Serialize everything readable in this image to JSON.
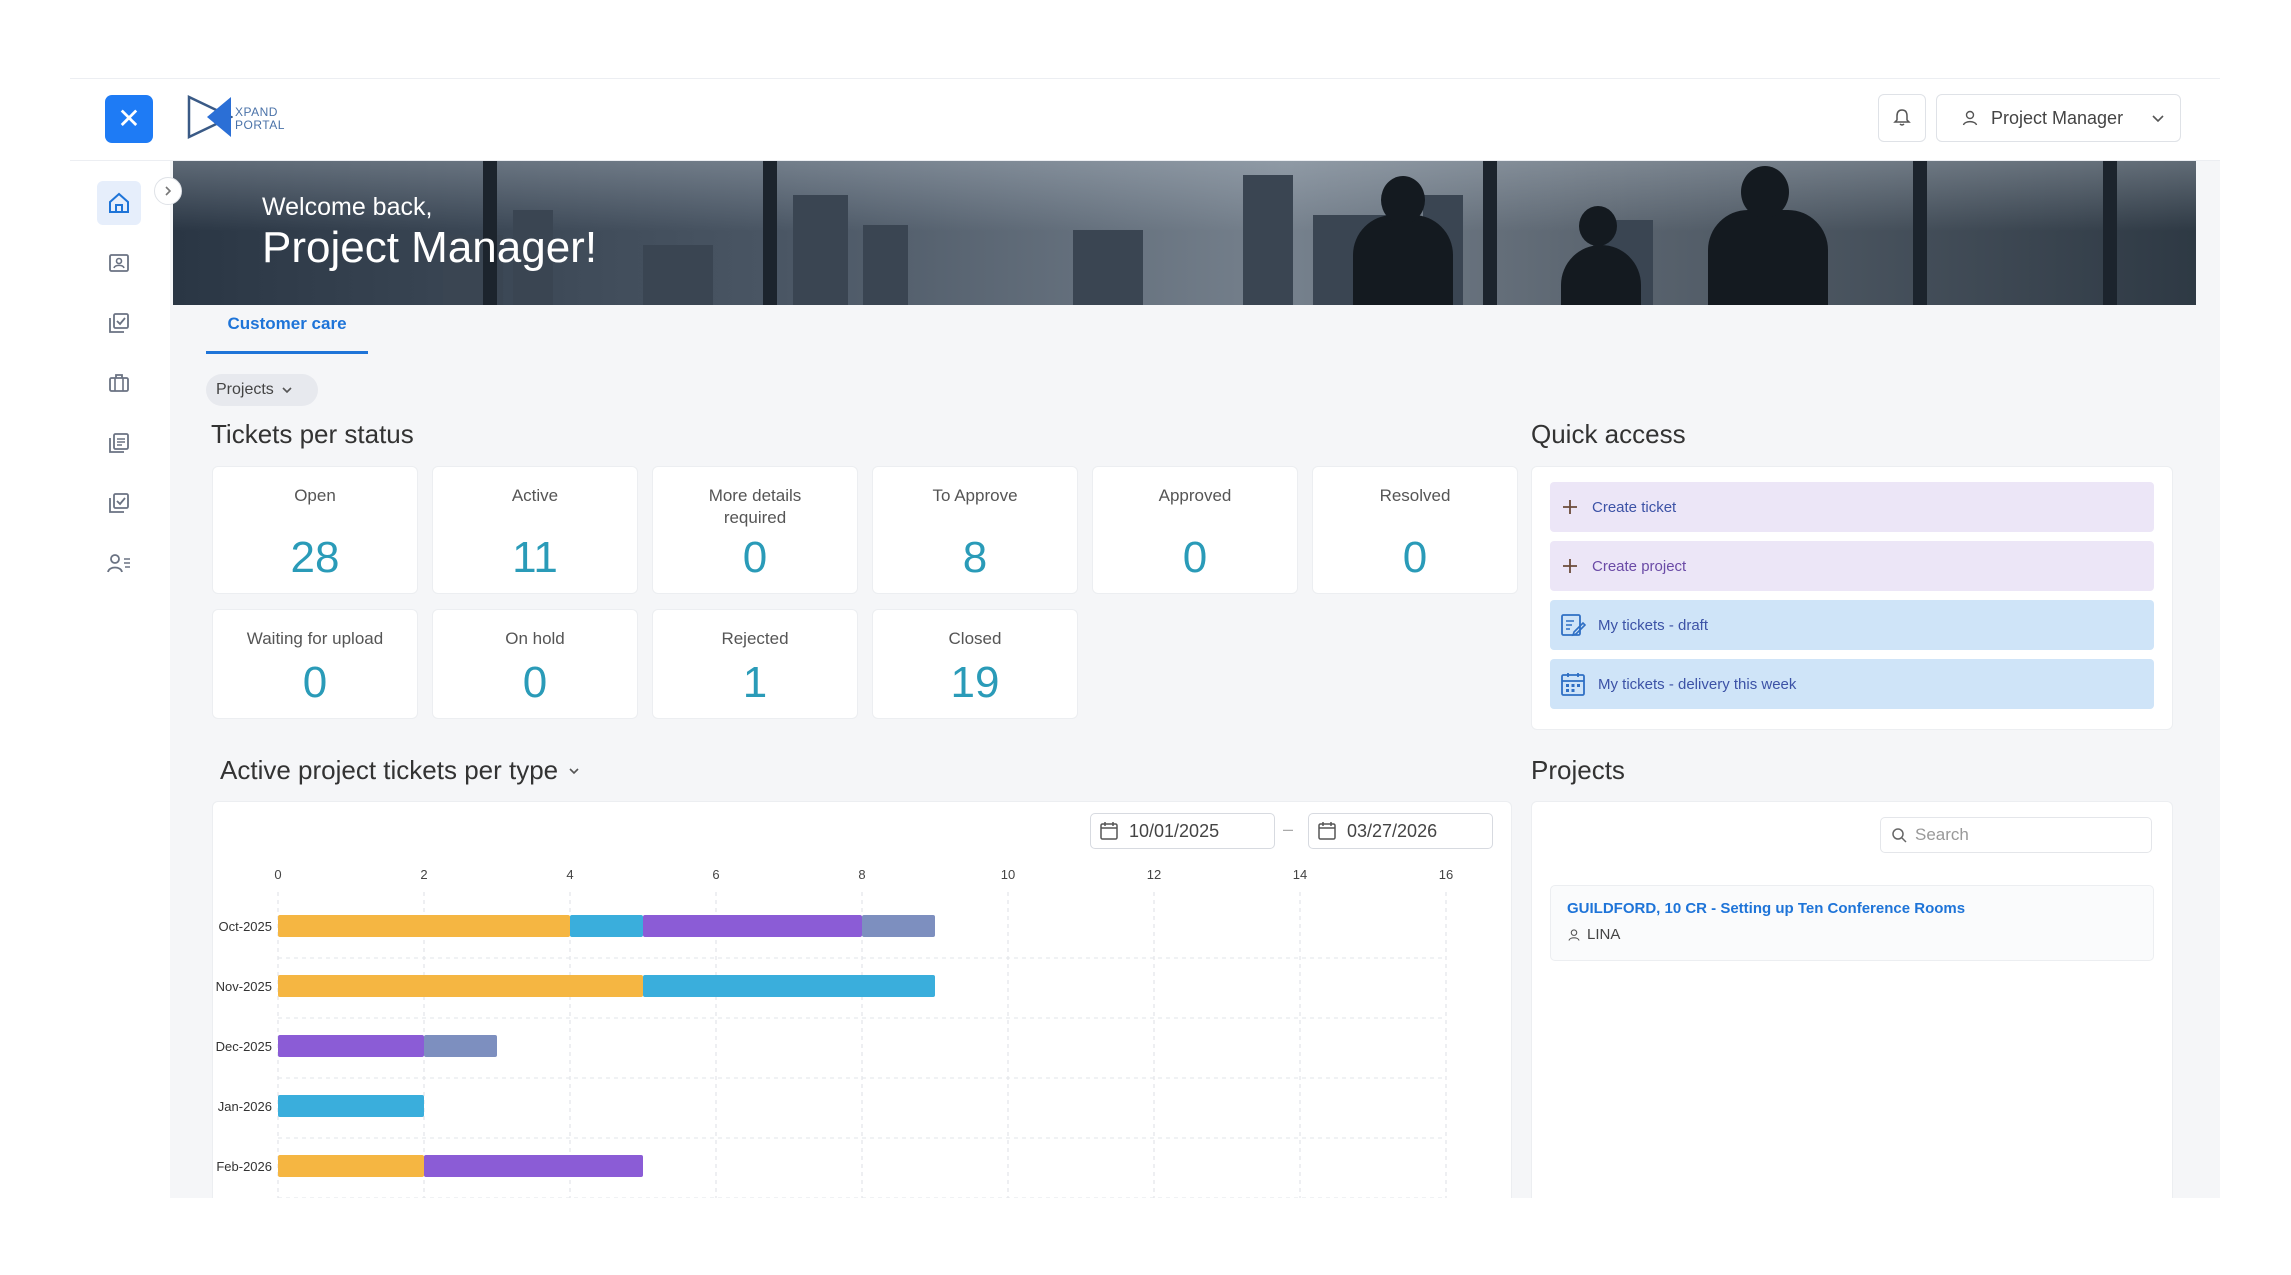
{
  "topbar": {
    "logo_text_line1": "XPAND",
    "logo_text_line2": "PORTAL",
    "user_label": "Project Manager"
  },
  "banner": {
    "greeting": "Welcome back,",
    "name": "Project Manager!"
  },
  "tabs": [
    {
      "label": "Customer care",
      "active": true
    }
  ],
  "filter": {
    "label": "Projects"
  },
  "tickets": {
    "title": "Tickets per status",
    "cards": [
      {
        "label": "Open",
        "value": "28"
      },
      {
        "label": "Active",
        "value": "11"
      },
      {
        "label": "More details required",
        "value": "0"
      },
      {
        "label": "To Approve",
        "value": "8"
      },
      {
        "label": "Approved",
        "value": "0"
      },
      {
        "label": "Resolved",
        "value": "0"
      },
      {
        "label": "Waiting for upload",
        "value": "0"
      },
      {
        "label": "On hold",
        "value": "0"
      },
      {
        "label": "Rejected",
        "value": "1"
      },
      {
        "label": "Closed",
        "value": "19"
      }
    ]
  },
  "quick_access": {
    "title": "Quick access",
    "items": [
      {
        "label": "Create ticket",
        "icon": "plus-icon",
        "style": "purple"
      },
      {
        "label": "Create project",
        "icon": "plus-icon",
        "style": "purple"
      },
      {
        "label": "My tickets - draft",
        "icon": "edit-list-icon",
        "style": "blue"
      },
      {
        "label": "My tickets - delivery this week",
        "icon": "calendar-icon",
        "style": "blue"
      }
    ]
  },
  "chart_section": {
    "title": "Active project tickets per type",
    "date_from": "10/01/2025",
    "date_separator": "–",
    "date_to": "03/27/2026"
  },
  "projects": {
    "title": "Projects",
    "search_placeholder": "Search",
    "items": [
      {
        "title": "GUILDFORD, 10 CR - Setting up Ten Conference Rooms",
        "owner": "LINA"
      }
    ]
  },
  "chart_data": {
    "type": "bar",
    "orientation": "horizontal",
    "stacked": true,
    "categories": [
      "Oct-2025",
      "Nov-2025",
      "Dec-2025",
      "Jan-2026",
      "Feb-2026"
    ],
    "xlim": [
      0,
      16
    ],
    "xticks": [
      0,
      2,
      4,
      6,
      8,
      10,
      12,
      14,
      16
    ],
    "grid": true,
    "series": [
      {
        "color": "#f5b642",
        "values": [
          4,
          5,
          0,
          0,
          2
        ]
      },
      {
        "color": "#3aaedc",
        "values": [
          1,
          4,
          0,
          2,
          0
        ]
      },
      {
        "color": "#8b5cd6",
        "values": [
          3,
          0,
          2,
          0,
          3
        ]
      },
      {
        "color": "#7d8fbf",
        "values": [
          1,
          0,
          1,
          0,
          0
        ]
      }
    ]
  }
}
